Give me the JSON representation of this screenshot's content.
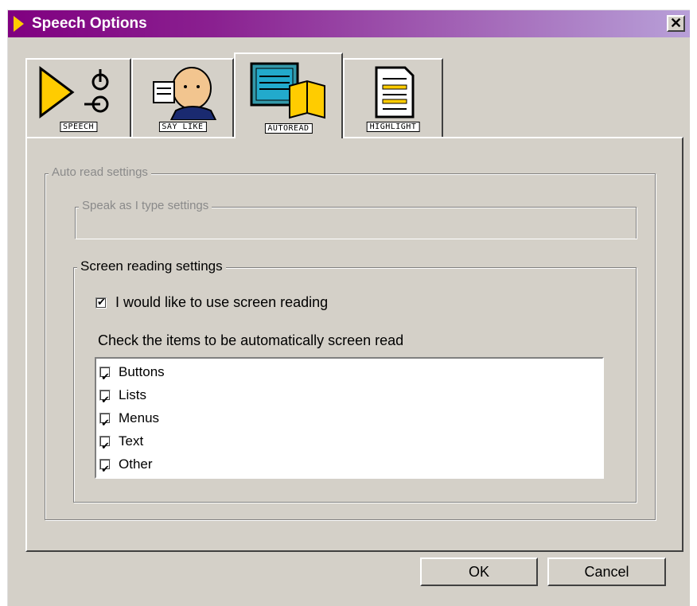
{
  "window": {
    "title": "Speech Options",
    "close_label": "✕"
  },
  "tabs": [
    {
      "label": "SPEECH",
      "icon": "speech-icon"
    },
    {
      "label": "SAY LIKE",
      "icon": "say-like-icon"
    },
    {
      "label": "AUTOREAD",
      "icon": "autoread-icon"
    },
    {
      "label": "HIGHLIGHT",
      "icon": "highlight-icon"
    }
  ],
  "active_tab": "AUTOREAD",
  "groups": {
    "auto_read": "Auto read settings",
    "speak_as_type": "Speak as I type settings",
    "screen_reading": "Screen reading settings"
  },
  "screen_reading": {
    "use_label": "I would like to use screen reading",
    "use_checked": true,
    "items_prompt": "Check the items to be automatically screen read",
    "items": [
      {
        "label": "Buttons",
        "checked": true
      },
      {
        "label": "Lists",
        "checked": true
      },
      {
        "label": "Menus",
        "checked": true
      },
      {
        "label": "Text",
        "checked": true
      },
      {
        "label": "Other",
        "checked": true
      }
    ]
  },
  "buttons": {
    "ok": "OK",
    "cancel": "Cancel"
  },
  "colors": {
    "face": "#d4d0c8",
    "title_start": "#800080",
    "title_end": "#b8a0d8",
    "icon_yellow": "#ffcc00"
  }
}
